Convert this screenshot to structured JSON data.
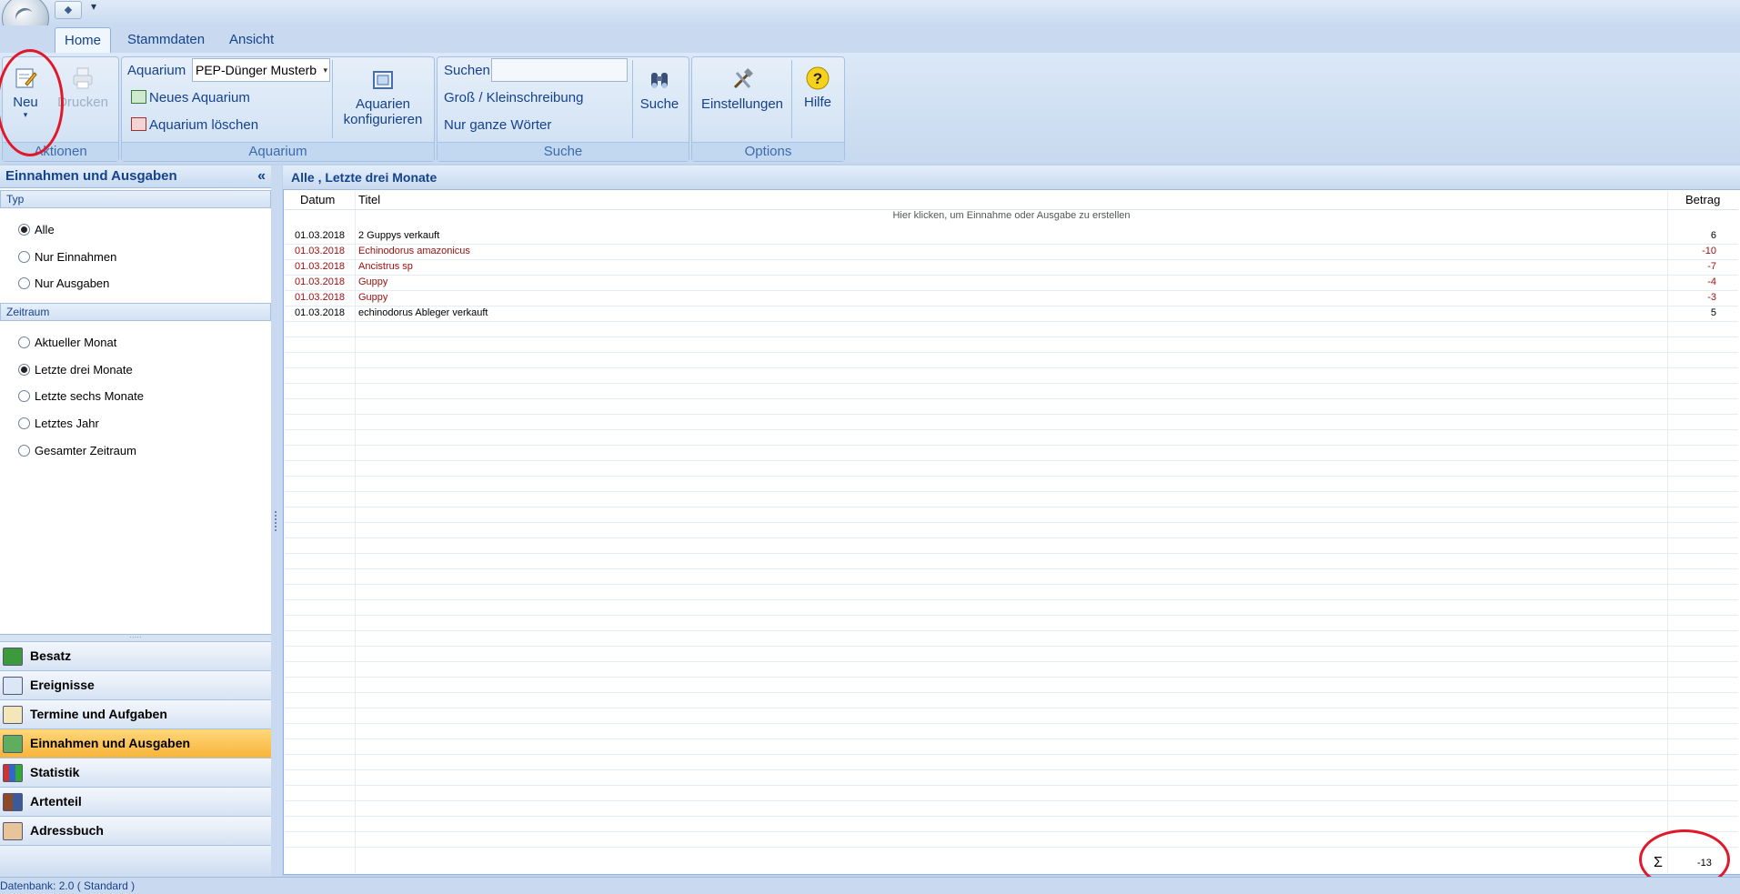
{
  "tabs": [
    {
      "label": "Home",
      "active": true
    },
    {
      "label": "Stammdaten",
      "active": false
    },
    {
      "label": "Ansicht",
      "active": false
    }
  ],
  "ribbon": {
    "aktionen": {
      "label": "Aktionen",
      "neu": "Neu",
      "drucken": "Drucken"
    },
    "aquarium": {
      "label": "Aquarium",
      "field_label": "Aquarium",
      "selected": "PEP-Dünger Musterb",
      "neues": "Neues Aquarium",
      "loeschen": "Aquarium löschen",
      "konfigurieren_line1": "Aquarien",
      "konfigurieren_line2": "konfigurieren"
    },
    "suche": {
      "label": "Suche",
      "suchen_label": "Suchen",
      "suchen_value": "",
      "gross_klein": "Groß / Kleinschreibung",
      "ganze_woerter": "Nur ganze Wörter",
      "suche_button": "Suche"
    },
    "options": {
      "label": "Options",
      "einstellungen": "Einstellungen",
      "hilfe": "Hilfe"
    }
  },
  "left_panel": {
    "title": "Einnahmen und Ausgaben",
    "collapse_glyph": "«",
    "typ": {
      "header": "Typ",
      "options": [
        "Alle",
        "Nur Einnahmen",
        "Nur Ausgaben"
      ],
      "selected": "Alle"
    },
    "zeitraum": {
      "header": "Zeitraum",
      "options": [
        "Aktueller Monat",
        "Letzte drei Monate",
        "Letzte sechs Monate",
        "Letztes Jahr",
        "Gesamter Zeitraum"
      ],
      "selected": "Letzte drei Monate"
    }
  },
  "nav": [
    {
      "label": "Besatz",
      "icon": "aquarium-icon",
      "active": false
    },
    {
      "label": "Ereignisse",
      "icon": "calendar-icon",
      "active": false
    },
    {
      "label": "Termine und Aufgaben",
      "icon": "checklist-icon",
      "active": false
    },
    {
      "label": "Einnahmen und Ausgaben",
      "icon": "money-icon",
      "active": true
    },
    {
      "label": "Statistik",
      "icon": "chart-icon",
      "active": false
    },
    {
      "label": "Artenteil",
      "icon": "books-icon",
      "active": false
    },
    {
      "label": "Adressbuch",
      "icon": "addressbook-icon",
      "active": false
    }
  ],
  "main": {
    "title": "Alle , Letzte drei Monate",
    "columns": {
      "datum": "Datum",
      "titel": "Titel",
      "betrag": "Betrag"
    },
    "new_row_hint": "Hier klicken, um Einnahme oder Ausgabe zu erstellen",
    "rows": [
      {
        "datum": "01.03.2018",
        "titel": "2 Guppys verkauft",
        "betrag": "6",
        "negative": false
      },
      {
        "datum": "01.03.2018",
        "titel": "Echinodorus amazonicus",
        "betrag": "-10",
        "negative": true
      },
      {
        "datum": "01.03.2018",
        "titel": "Ancistrus sp",
        "betrag": "-7",
        "negative": true
      },
      {
        "datum": "01.03.2018",
        "titel": "Guppy",
        "betrag": "-4",
        "negative": true
      },
      {
        "datum": "01.03.2018",
        "titel": "Guppy",
        "betrag": "-3",
        "negative": true
      },
      {
        "datum": "01.03.2018",
        "titel": "echinodorus Ableger verkauft",
        "betrag": "5",
        "negative": false
      }
    ],
    "sum_symbol": "Σ",
    "sum_value": "-13"
  },
  "statusbar": {
    "text": "Datenbank: 2.0 ( Standard )"
  },
  "colors": {
    "highlight_ellipse": "#e0182a",
    "negative_text": "#a01010",
    "active_nav": "#f8b43a"
  }
}
